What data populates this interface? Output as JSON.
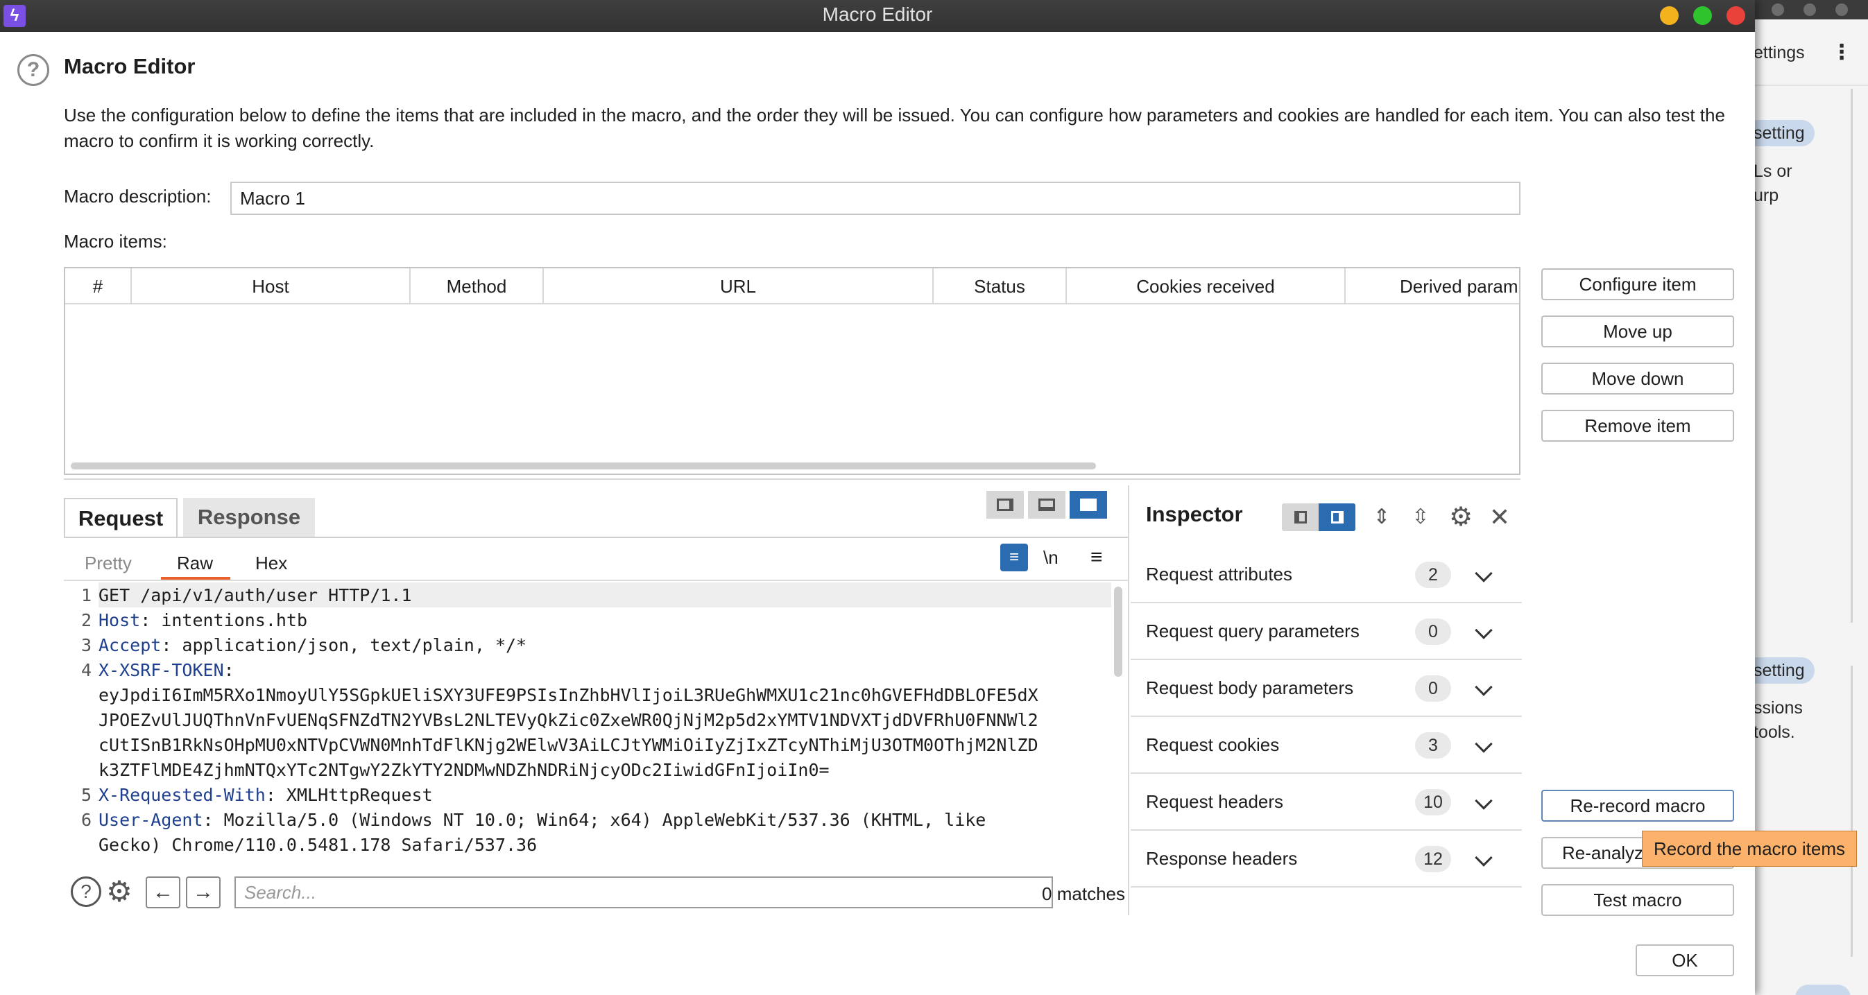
{
  "window": {
    "title": "Macro Editor",
    "app_icon": "lightning-icon",
    "accent_color": "#2b6cb0",
    "tooltip_color": "#fcb26b"
  },
  "header": {
    "heading": "Macro Editor",
    "description": "Use the configuration below to define the items that are included in the macro, and the order they will be issued. You can configure how parameters and cookies are handled for each item. You can also test the macro to confirm it is working correctly."
  },
  "form": {
    "description_label": "Macro description:",
    "description_value": "Macro 1",
    "items_label": "Macro items:"
  },
  "table": {
    "columns": [
      "#",
      "Host",
      "Method",
      "URL",
      "Status",
      "Cookies received",
      "Derived param"
    ]
  },
  "side_buttons": {
    "configure_item": "Configure item",
    "move_up": "Move up",
    "move_down": "Move down",
    "remove_item": "Remove item",
    "re_record_macro": "Re-record macro",
    "re_analyze": "Re-analyze macro",
    "test_macro": "Test macro",
    "ok": "OK"
  },
  "tooltip": "Record the macro items",
  "editor": {
    "tabs": [
      "Request",
      "Response"
    ],
    "subtabs": [
      "Pretty",
      "Raw",
      "Hex"
    ],
    "newline_toggle": "\\n",
    "lines": [
      {
        "num": "1",
        "text": "GET /api/v1/auth/user HTTP/1.1"
      },
      {
        "num": "2",
        "name": "Host",
        "value": ": intentions.htb"
      },
      {
        "num": "3",
        "name": "Accept",
        "value": ": application/json, text/plain, */*"
      },
      {
        "num": "4",
        "name": "X-XSRF-TOKEN",
        "value": ":"
      },
      {
        "num": "",
        "text": "eyJpdiI6ImM5RXo1NmoyUlY5SGpkUEliSXY3UFE9PSIsInZhbHVlIjoiL3RUeGhWMXU1c21nc0hGVEFHdDBLOFE5dX"
      },
      {
        "num": "",
        "text": "JPOEZvUlJUQThnVnFvUENqSFNZdTN2YVBsL2NLTEVyQkZic0ZxeWR0QjNjM2p5d2xYMTV1NDVXTjdDVFRhU0FNNWl2"
      },
      {
        "num": "",
        "text": "cUtISnB1RkNsOHpMU0xNTVpCVWN0MnhTdFlKNjg2WElwV3AiLCJtYWMiOiIyZjIxZTcyNThiMjU3OTM0OThjM2NlZD"
      },
      {
        "num": "",
        "text": "k3ZTFlMDE4ZjhmNTQxYTc2NTgwY2ZkYTY2NDMwNDZhNDRiNjcyODc2IiwidGFnIjoiIn0="
      },
      {
        "num": "5",
        "name": "X-Requested-With",
        "value": ": XMLHttpRequest"
      },
      {
        "num": "6",
        "name": "User-Agent",
        "value": ": Mozilla/5.0 (Windows NT 10.0; Win64; x64) AppleWebKit/537.36 (KHTML, like"
      },
      {
        "num": "",
        "text": "Gecko) Chrome/110.0.5481.178 Safari/537.36"
      }
    ],
    "search_placeholder": "Search...",
    "match_count": "0 matches"
  },
  "inspector": {
    "title": "Inspector",
    "rows": [
      {
        "label": "Request attributes",
        "count": "2"
      },
      {
        "label": "Request query parameters",
        "count": "0"
      },
      {
        "label": "Request body parameters",
        "count": "0"
      },
      {
        "label": "Request cookies",
        "count": "3"
      },
      {
        "label": "Request headers",
        "count": "10"
      },
      {
        "label": "Response headers",
        "count": "12"
      }
    ]
  },
  "background_window": {
    "settings_label": "ettings",
    "pill_top": "setting",
    "text_top_1": "Ls or",
    "text_top_2": "urp",
    "pill_bottom": "setting",
    "text_bottom_1": "ssions",
    "text_bottom_2": "tools."
  }
}
